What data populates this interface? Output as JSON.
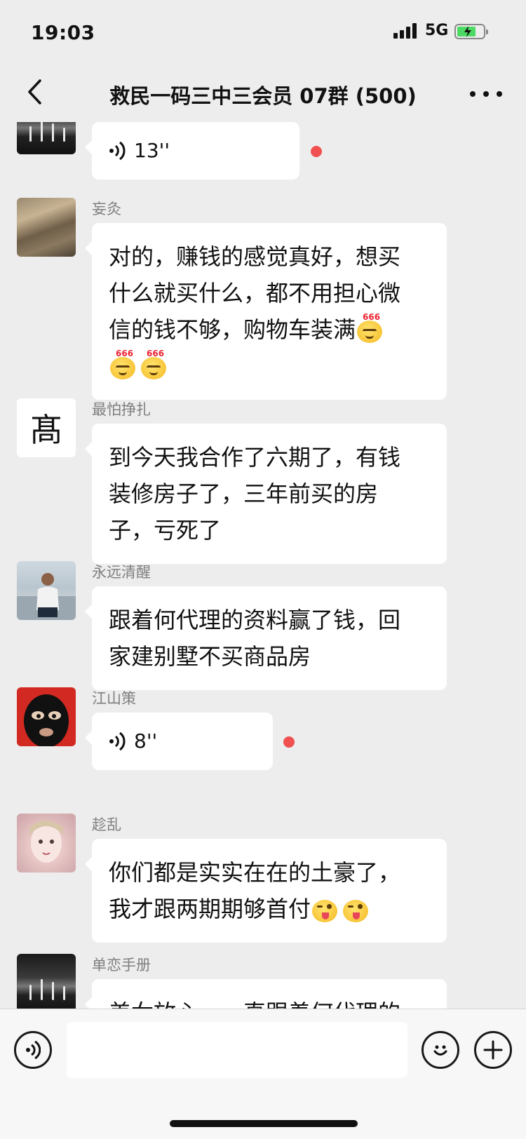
{
  "status": {
    "time": "19:03",
    "network": "5G"
  },
  "nav": {
    "title": "救民一码三中三会员 07群 (500)"
  },
  "messages": [
    {
      "duration": "13''"
    },
    {
      "sender": "妄灸",
      "lines": [
        "对的，赚钱的感觉真好，想买",
        "什么就买什么，都不用担心微",
        "信的钱不够，购物车装满"
      ],
      "emoji_label": "666"
    },
    {
      "sender": "最怕挣扎",
      "avatar_text": "髙",
      "lines": [
        "到今天我合作了六期了，有钱",
        "装修房子了，三年前买的房",
        "子，亏死了"
      ]
    },
    {
      "sender": "永远清醒",
      "lines": [
        "跟着何代理的资料赢了钱，回",
        "家建别墅不买商品房"
      ]
    },
    {
      "sender": "江山策",
      "duration": "8''"
    },
    {
      "sender": "趁乱",
      "lines": [
        "你们都是实实在在的土豪了，",
        "我才跟两期期够首付"
      ]
    },
    {
      "sender": "单恋手册",
      "lines": [
        "美女放心，一直跟着何代理的"
      ]
    }
  ],
  "colors": {
    "background": "#ededed",
    "bubble": "#ffffff",
    "unread_dot": "#f05050",
    "sender_text": "#7f7f7f"
  },
  "icons": [
    "back-chevron",
    "more-dots",
    "voice-wave",
    "emoji-smile",
    "plus"
  ]
}
